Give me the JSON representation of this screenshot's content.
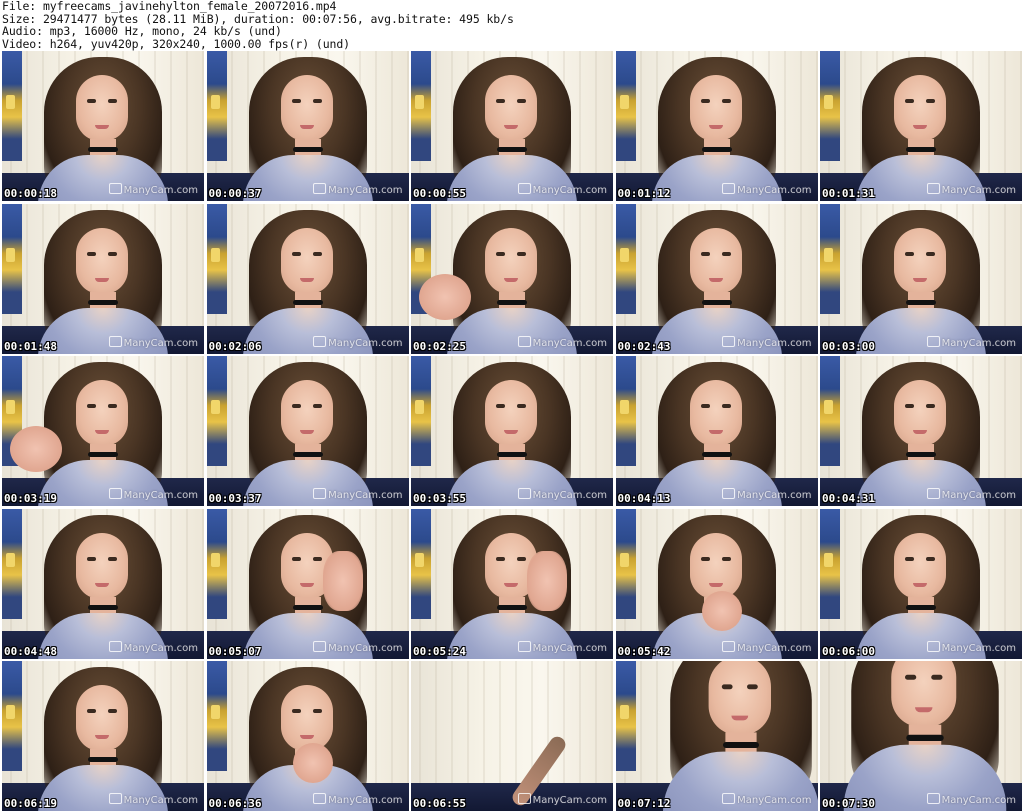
{
  "header": {
    "file_line": "File: myfreecams_javinehylton_female_20072016.mp4",
    "size_line": "Size: 29471477 bytes (28.11 MiB), duration: 00:07:56, avg.bitrate: 495 kb/s",
    "audio_line": "Audio: mp3, 16000 Hz, mono, 24 kb/s (und)",
    "video_line": "Video: h264, yuv420p, 320x240, 1000.00 fps(r) (und)"
  },
  "watermark": "ManyCam.com",
  "thumbnails": [
    {
      "timestamp": "00:00:18"
    },
    {
      "timestamp": "00:00:37"
    },
    {
      "timestamp": "00:00:55"
    },
    {
      "timestamp": "00:01:12"
    },
    {
      "timestamp": "00:01:31"
    },
    {
      "timestamp": "00:01:48"
    },
    {
      "timestamp": "00:02:06"
    },
    {
      "timestamp": "00:02:25"
    },
    {
      "timestamp": "00:02:43"
    },
    {
      "timestamp": "00:03:00"
    },
    {
      "timestamp": "00:03:19"
    },
    {
      "timestamp": "00:03:37"
    },
    {
      "timestamp": "00:03:55"
    },
    {
      "timestamp": "00:04:13"
    },
    {
      "timestamp": "00:04:31"
    },
    {
      "timestamp": "00:04:48"
    },
    {
      "timestamp": "00:05:07"
    },
    {
      "timestamp": "00:05:24"
    },
    {
      "timestamp": "00:05:42"
    },
    {
      "timestamp": "00:06:00"
    },
    {
      "timestamp": "00:06:19"
    },
    {
      "timestamp": "00:06:36"
    },
    {
      "timestamp": "00:06:55"
    },
    {
      "timestamp": "00:07:12"
    },
    {
      "timestamp": "00:07:30"
    }
  ]
}
